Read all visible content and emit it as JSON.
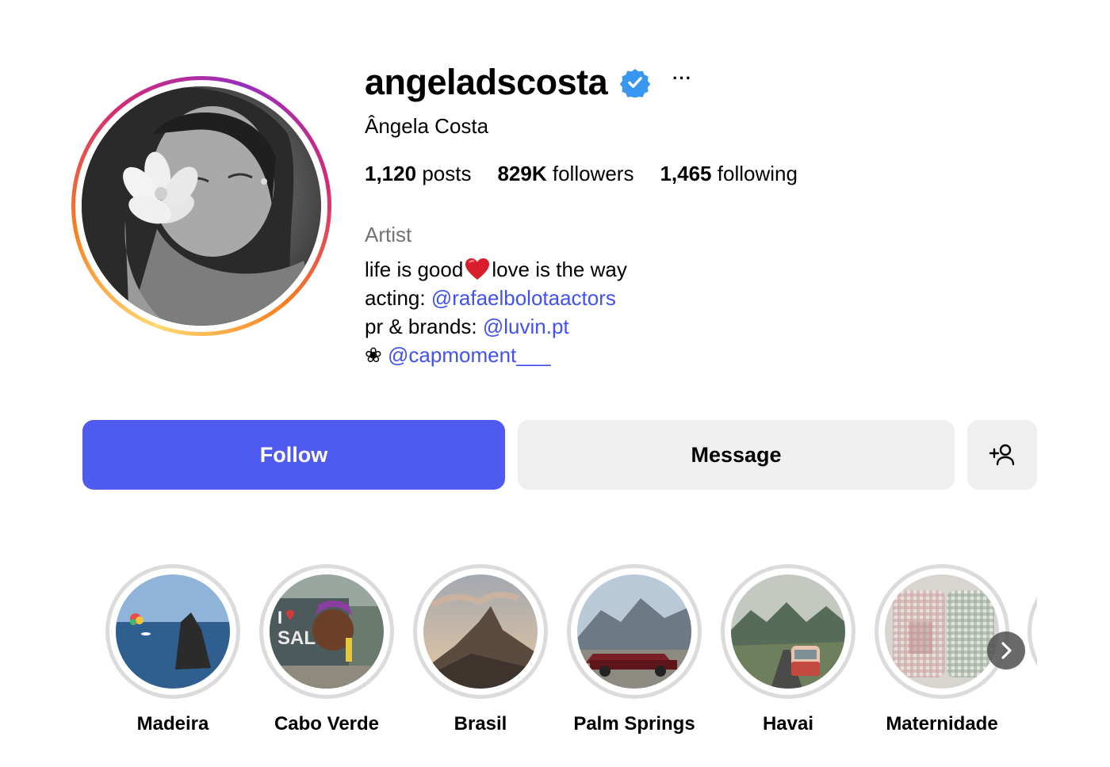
{
  "profile": {
    "username": "angeladscosta",
    "full_name": "Ângela Costa",
    "verified": true,
    "more_label": "···",
    "stats": {
      "posts_count": "1,120",
      "posts_label": "posts",
      "followers_count": "829K",
      "followers_label": "followers",
      "following_count": "1,465",
      "following_label": "following"
    },
    "category": "Artist",
    "bio": {
      "line1_a": "life is good",
      "line1_b": "love is the way",
      "line2_prefix": "acting: ",
      "line2_mention": "@rafaelbolotaactors",
      "line3_prefix": "pr & brands: ",
      "line3_mention": "@luvin.pt",
      "line4_prefix": "❀ ",
      "line4_mention": "@capmoment___"
    }
  },
  "actions": {
    "follow_label": "Follow",
    "message_label": "Message",
    "add_person_icon": "add-person-icon"
  },
  "highlights": [
    {
      "label": "Madeira"
    },
    {
      "label": "Cabo Verde"
    },
    {
      "label": "Brasil"
    },
    {
      "label": "Palm Springs"
    },
    {
      "label": "Havai"
    },
    {
      "label": "Maternidade"
    }
  ],
  "colors": {
    "accent_blue": "#4f5bef",
    "mention_blue": "#4150f7",
    "verified_blue": "#3897f0",
    "secondary_text": "#737373",
    "button_gray": "#efefef"
  }
}
